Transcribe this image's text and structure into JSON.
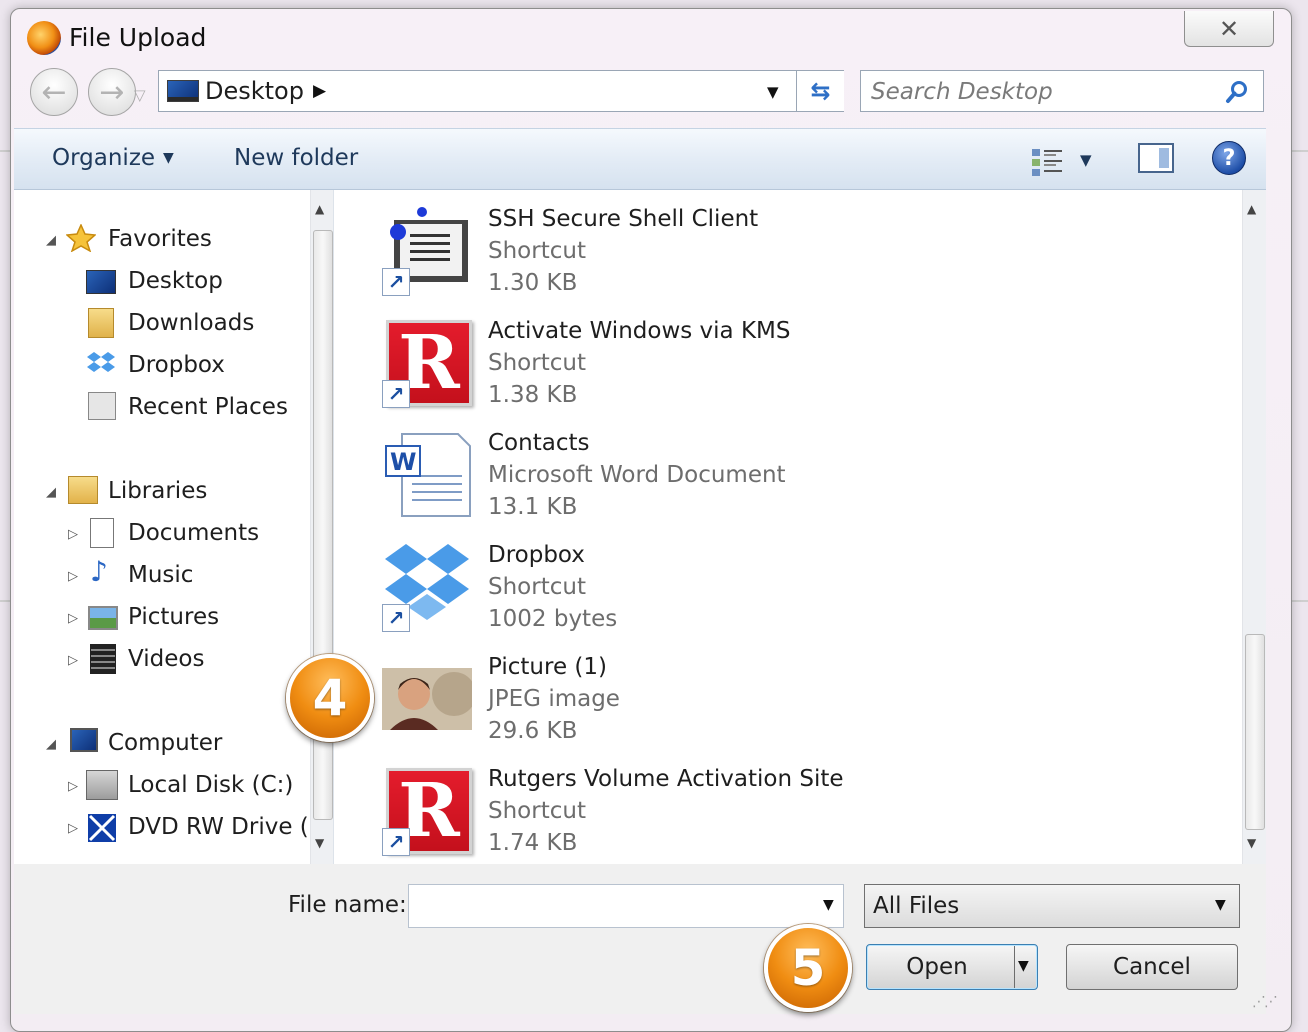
{
  "window": {
    "title": "File Upload",
    "close_symbol": "✕"
  },
  "nav": {
    "back_symbol": "←",
    "forward_symbol": "→"
  },
  "address": {
    "location": "Desktop"
  },
  "search": {
    "placeholder": "Search Desktop",
    "value": ""
  },
  "toolbar": {
    "organize": "Organize",
    "new_folder": "New folder",
    "help": "?"
  },
  "sidebar": {
    "favorites": {
      "header": "Favorites",
      "items": [
        {
          "label": "Desktop",
          "icon": "desktop-icon"
        },
        {
          "label": "Downloads",
          "icon": "downloads-icon"
        },
        {
          "label": "Dropbox",
          "icon": "dropbox-icon"
        },
        {
          "label": "Recent Places",
          "icon": "recent-places-icon"
        }
      ]
    },
    "libraries": {
      "header": "Libraries",
      "items": [
        {
          "label": "Documents",
          "icon": "documents-icon"
        },
        {
          "label": "Music",
          "icon": "music-icon"
        },
        {
          "label": "Pictures",
          "icon": "pictures-icon"
        },
        {
          "label": "Videos",
          "icon": "videos-icon"
        }
      ]
    },
    "computer": {
      "header": "Computer",
      "items": [
        {
          "label": "Local Disk (C:)",
          "icon": "local-disk-icon"
        },
        {
          "label": "DVD RW Drive (D",
          "icon": "dvd-drive-icon"
        }
      ]
    }
  },
  "files": [
    {
      "name": "SSH Secure Shell Client",
      "type": "Shortcut",
      "size": "1.30 KB",
      "icon": "ssh-client-icon"
    },
    {
      "name": "Activate Windows via KMS",
      "type": "Shortcut",
      "size": "1.38 KB",
      "icon": "rutgers-r-icon"
    },
    {
      "name": "Contacts",
      "type": "Microsoft Word Document",
      "size": "13.1 KB",
      "icon": "word-document-icon"
    },
    {
      "name": "Dropbox",
      "type": "Shortcut",
      "size": "1002 bytes",
      "icon": "dropbox-icon"
    },
    {
      "name": "Picture (1)",
      "type": "JPEG image",
      "size": "29.6 KB",
      "icon": "photo-thumbnail"
    },
    {
      "name": "Rutgers Volume Activation Site",
      "type": "Shortcut",
      "size": "1.74 KB",
      "icon": "rutgers-r-icon"
    }
  ],
  "bottom": {
    "file_name_label": "File name:",
    "file_name_value": "",
    "filter": "All Files",
    "open": "Open",
    "cancel": "Cancel"
  },
  "callouts": {
    "step4": "4",
    "step5": "5"
  },
  "colors": {
    "callout_orange": "#f08d12",
    "toolbar_text": "#1e395b",
    "accent_blue": "#2e6fc6"
  }
}
